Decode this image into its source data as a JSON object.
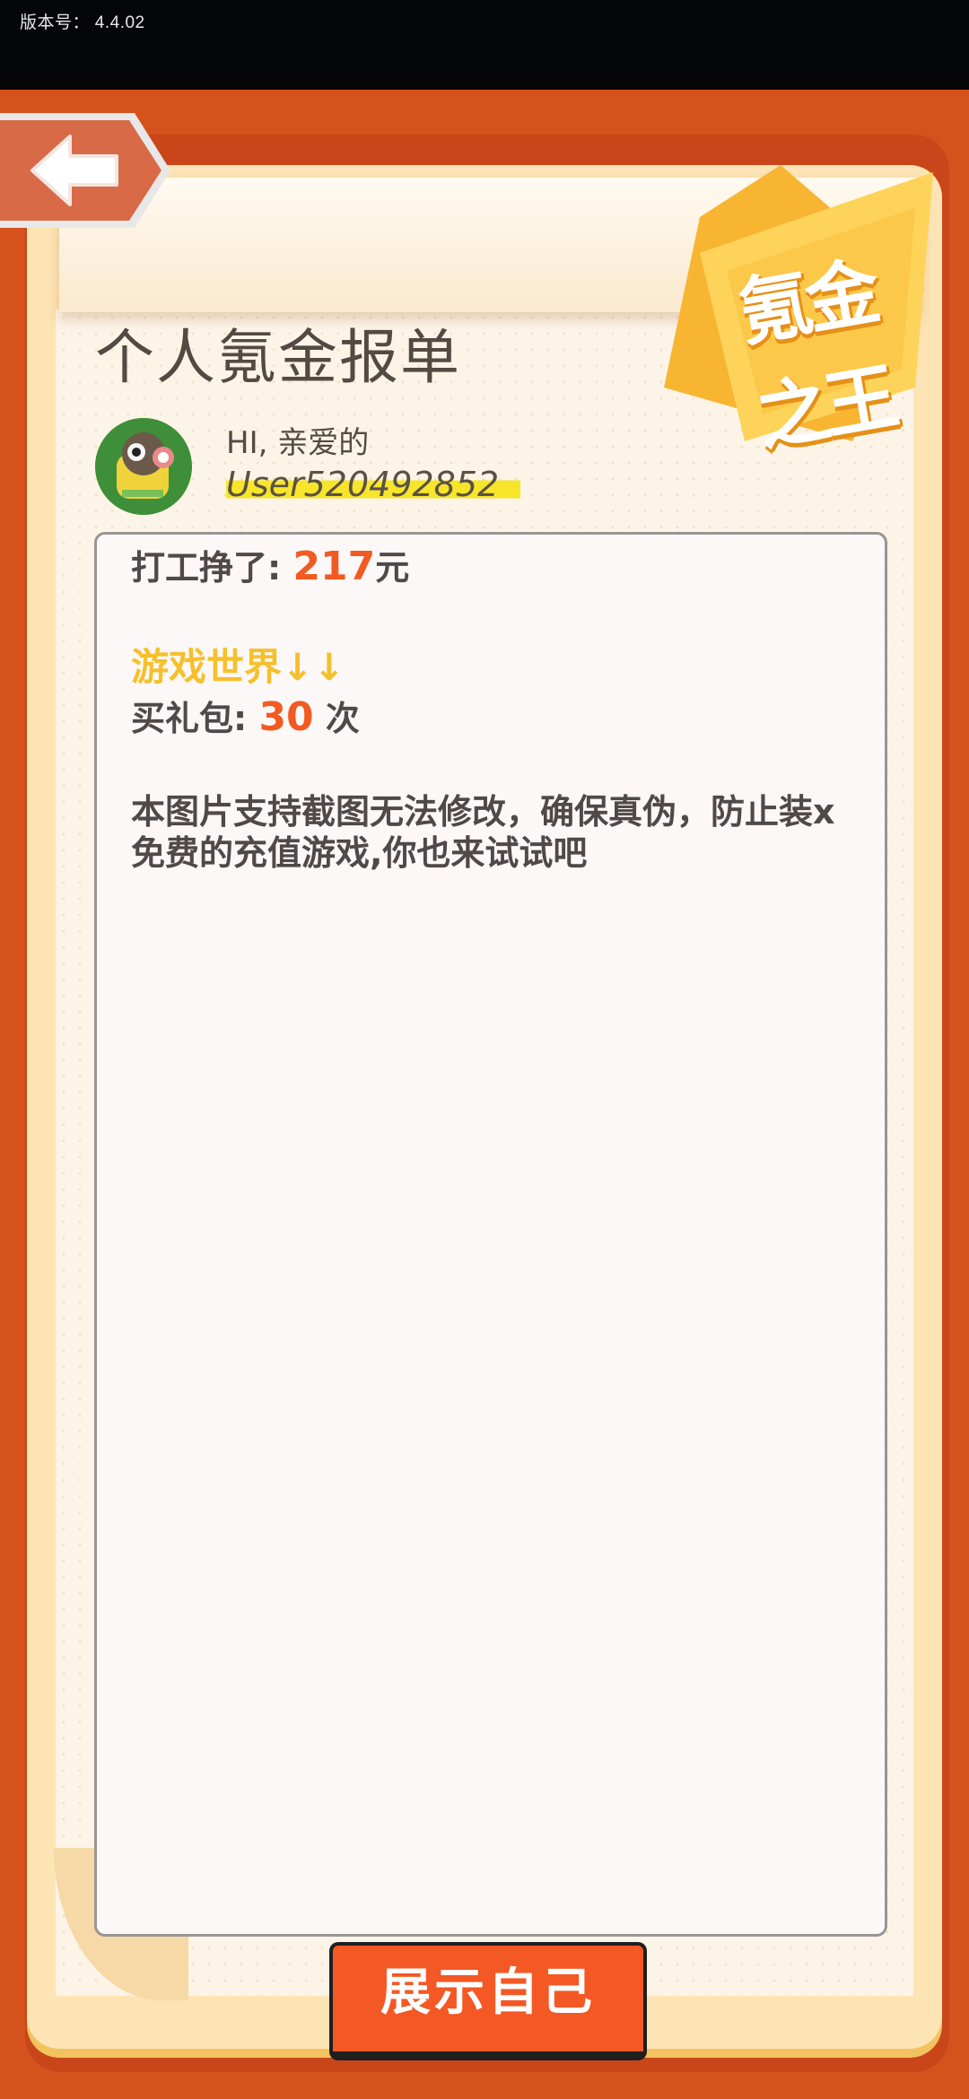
{
  "status_bar": {
    "version_label": "版本号：  4.4.02"
  },
  "header": {
    "back_icon": "arrow-left-icon",
    "title": "个人氪金报单",
    "badge_text": "氪金之王"
  },
  "user": {
    "greeting": "HI, 亲爱的",
    "username": "User520492852",
    "avatar_icon": "robot-avatar"
  },
  "report": {
    "earn_label": "打工挣了:",
    "earn_value": "217",
    "earn_unit": "元",
    "game_world": "游戏世界↓↓",
    "gift_label": "买礼包:",
    "gift_value": "30",
    "gift_unit": "次",
    "notice_line1": "本图片支持截图无法修改，确保真伪，防止装x",
    "notice_line2": "免费的充值游戏,你也来试试吧"
  },
  "footer": {
    "show_button": "展示自己"
  },
  "colors": {
    "frame": "#d6521c",
    "accent_number": "#f25a22",
    "game_world": "#f6c02c",
    "button": "#f45824",
    "highlight": "#f7e52a"
  }
}
